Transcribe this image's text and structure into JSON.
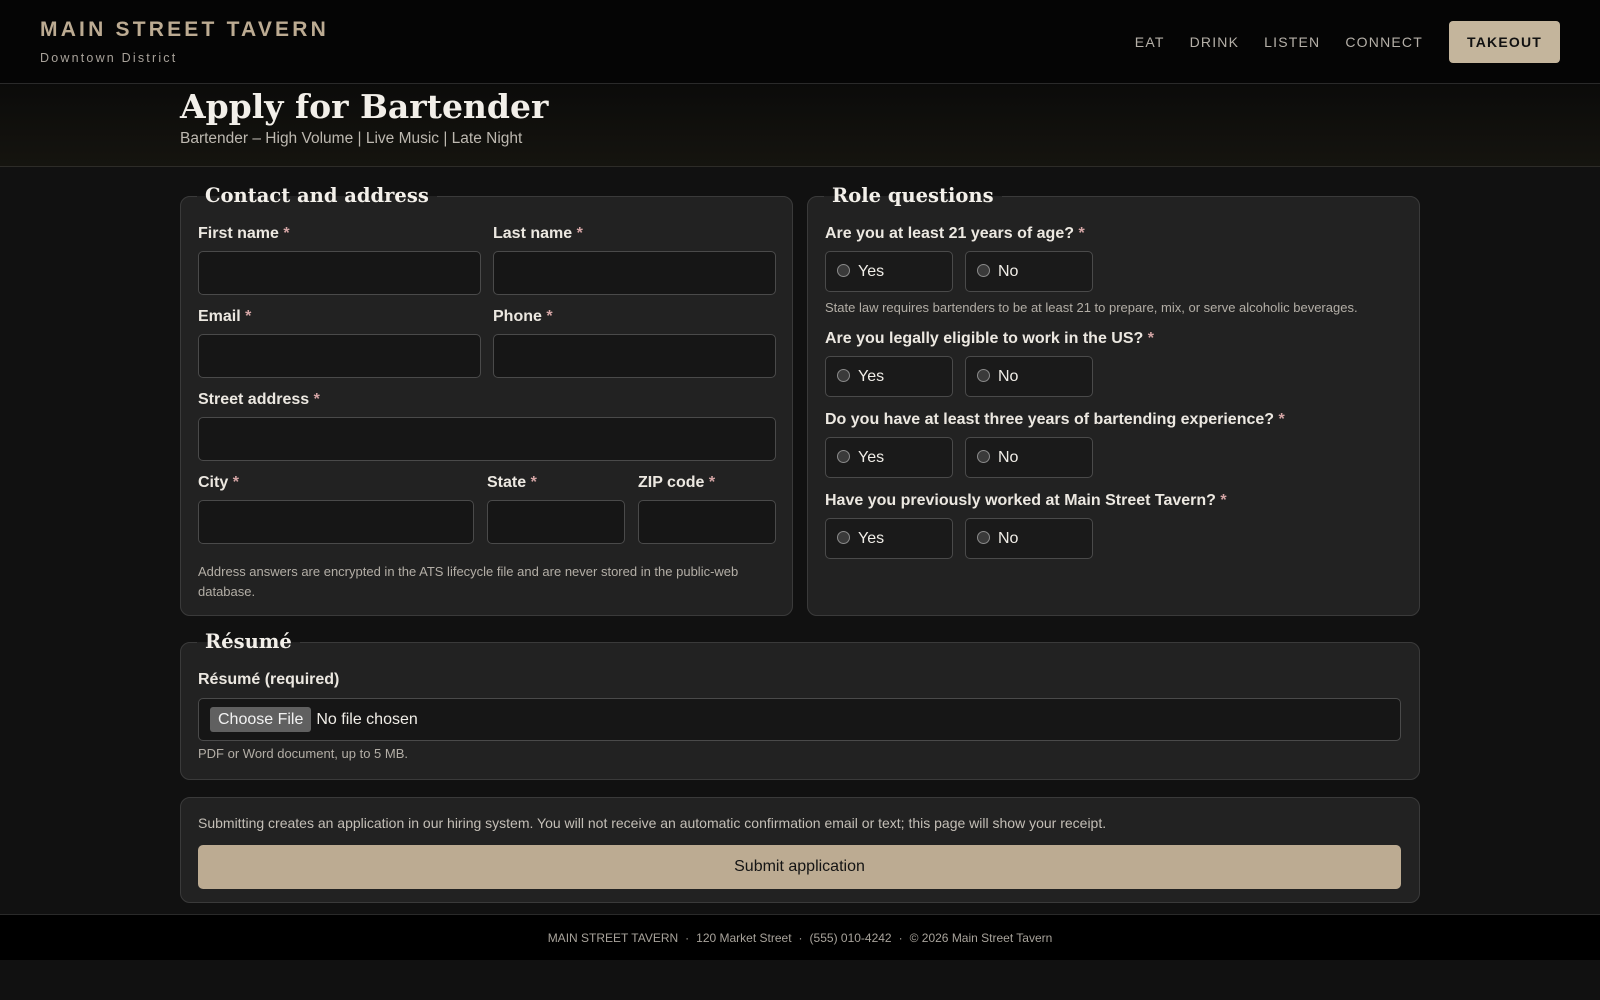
{
  "header": {
    "brand_name": "MAIN STREET TAVERN",
    "brand_sub": "Downtown District",
    "nav": [
      "EAT",
      "DRINK",
      "LISTEN",
      "CONNECT"
    ],
    "cta": "TAKEOUT"
  },
  "hero": {
    "title": "Apply for Bartender",
    "subtitle": "Bartender – High Volume | Live Music | Late Night"
  },
  "required_marker": "*",
  "contact": {
    "legend": "Contact and address",
    "first_name": "First name",
    "last_name": "Last name",
    "email": "Email",
    "phone": "Phone",
    "street": "Street address",
    "city": "City",
    "state": "State",
    "zip": "ZIP code",
    "note": "Address answers are encrypted in the ATS lifecycle file and are never stored in the public-web database."
  },
  "role": {
    "legend": "Role questions",
    "yes": "Yes",
    "no": "No",
    "questions": [
      "Are you at least 21 years of age?",
      "Are you legally eligible to work in the US?",
      "Do you have at least three years of bartending experience?",
      "Have you previously worked at Main Street Tavern?"
    ],
    "age_note": "State law requires bartenders to be at least 21 to prepare, mix, or serve alcoholic beverages."
  },
  "resume": {
    "legend": "Résumé",
    "label": "Résumé (required)",
    "button": "Choose File",
    "status": "No file chosen",
    "note": "PDF or Word document, up to 5 MB."
  },
  "submit": {
    "note": "Submitting creates an application in our hiring system. You will not receive an automatic confirmation email or text; this page will show your receipt.",
    "button": "Submit application"
  },
  "footer": {
    "name": "MAIN STREET TAVERN",
    "address": "120 Market Street",
    "phone": "(555) 010-4242",
    "copyright": "© 2026 Main Street Tavern",
    "separator": "·"
  }
}
